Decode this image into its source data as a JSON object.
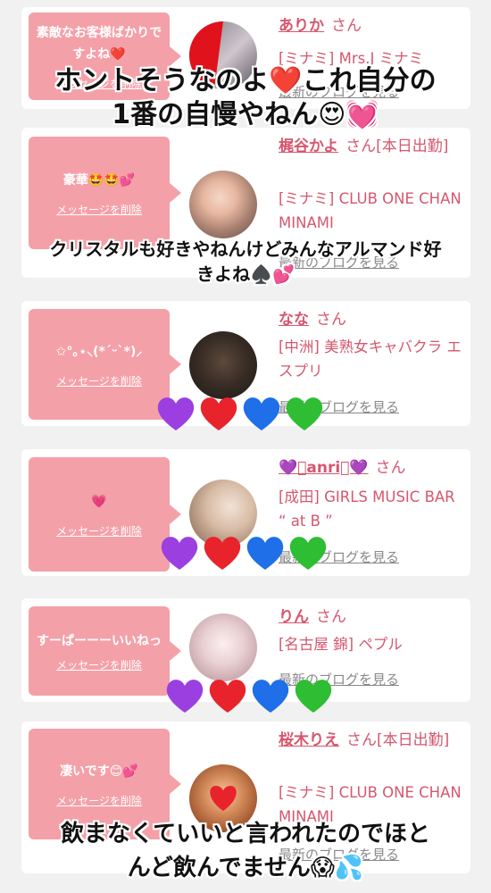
{
  "cards": [
    {
      "bubble_text": "素敵なお客様ばかりですよね❤️",
      "delete_label": "メッセージを削除",
      "name": "ありか",
      "honorific": "さん",
      "shop": "[ミナミ] Mrs.J ミナミ",
      "blog_label": "最新のブログを見る"
    },
    {
      "bubble_text": "豪華🤩🤩💕",
      "delete_label": "メッセージを削除",
      "name": "梶谷かよ",
      "honorific": "さん[本日出勤]",
      "shop": "[ミナミ] CLUB ONE CHAN MINAMI",
      "blog_label": "最新のブログを見る"
    },
    {
      "bubble_text": "✩°｡⋆⸜(*ˊᵕˋ*)⸝",
      "delete_label": "メッセージを削除",
      "name": "なな",
      "honorific": "さん",
      "shop": "[中洲] 美熟女キャバクラ エスプリ",
      "blog_label": "最新のブログを見る"
    },
    {
      "bubble_text": "💗",
      "delete_label": "メッセージを削除",
      "name": "💜⃝anri⃝💜",
      "honorific": "さん",
      "shop": "[成田] GIRLS MUSIC BAR “ at B ”",
      "blog_label": "最新のブログを見る"
    },
    {
      "bubble_text": "すーぱーーーいいねっ",
      "delete_label": "メッセージを削除",
      "name": "りん",
      "honorific": "さん",
      "shop": "[名古屋 錦] ペプル",
      "blog_label": "最新のブログを見る"
    },
    {
      "bubble_text": "凄いです😊💕",
      "delete_label": "メッセージを削除",
      "name": "桜木りえ",
      "honorific": "さん[本日出勤]",
      "shop": "[ミナミ] CLUB ONE CHAN MINAMI",
      "blog_label": "最新のブログを見る"
    }
  ],
  "captions": {
    "first_line1": "ホントそうなのよ❤️これ自分の",
    "first_line2": "1番の自慢やねん😍💓",
    "second_line1": "クリスタルも好きやねんけどみんなアルマンド好",
    "second_line2": "きよね♠️💕",
    "last_line1": "飲まなくていいと言われたのでほと",
    "last_line2": "んど飲んでません😱💦"
  },
  "colors": {
    "bubble": "#f4a0a8",
    "name_pink": "#d6576e",
    "heart_purple": "#9b3fe0",
    "heart_red": "#e8232b",
    "heart_blue": "#1e6fe8",
    "heart_green": "#2ebd33"
  }
}
